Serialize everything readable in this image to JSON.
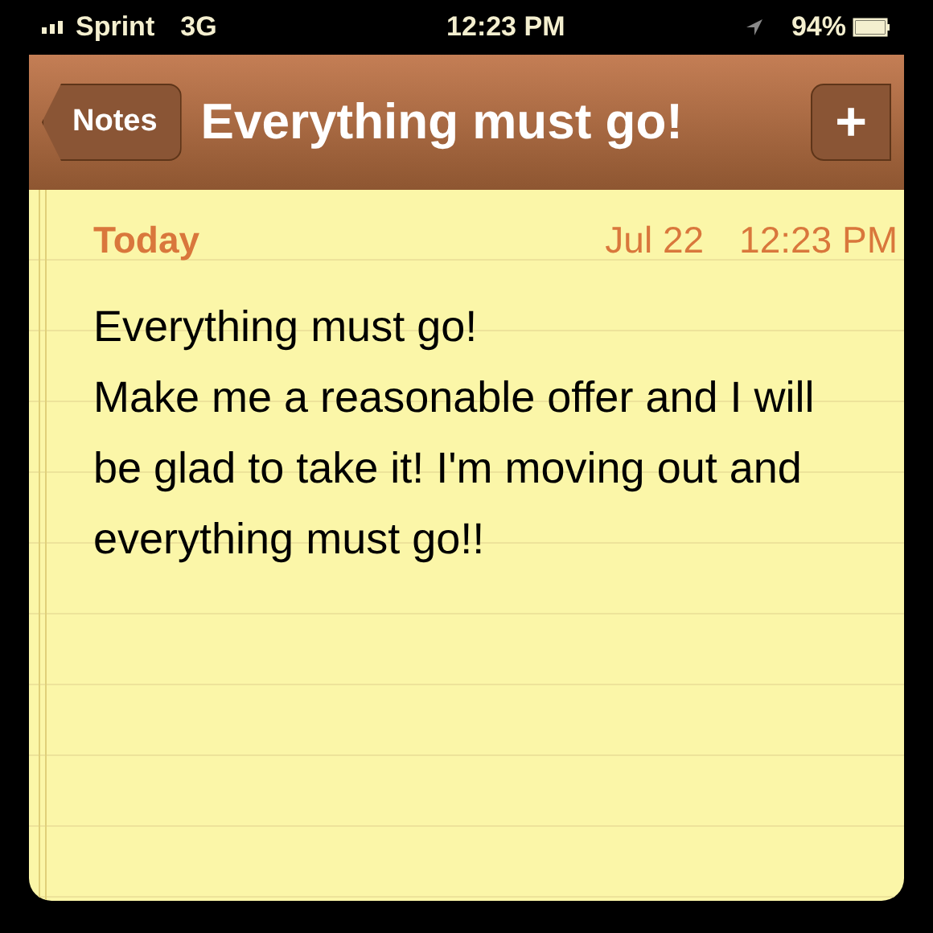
{
  "status_bar": {
    "carrier": "Sprint",
    "network": "3G",
    "time": "12:23 PM",
    "battery": "94%"
  },
  "nav_bar": {
    "back_button": "Notes",
    "title": "Everything must go!",
    "add_button": "+"
  },
  "note": {
    "day": "Today",
    "date": "Jul 22",
    "time": "12:23 PM",
    "paragraphs": [
      "Everything must go!",
      "Make me a reasonable offer and I will be glad to take it! I'm moving out and everything must go!!"
    ]
  }
}
